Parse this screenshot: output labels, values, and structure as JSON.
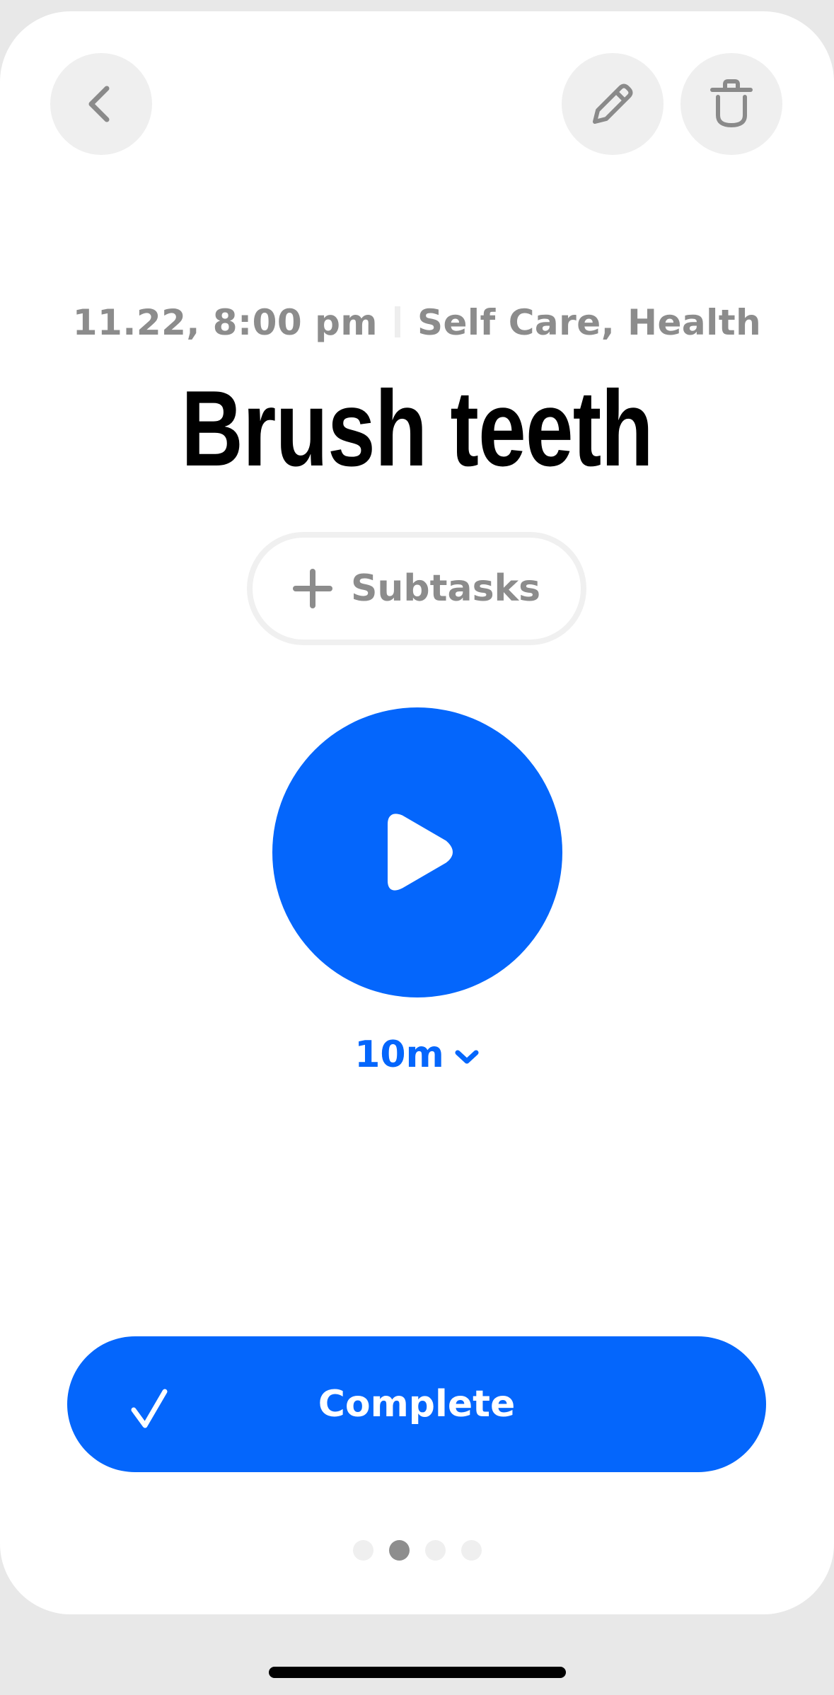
{
  "header": {
    "back_icon": "chevron-left-icon",
    "edit_icon": "pencil-icon",
    "delete_icon": "trash-icon"
  },
  "task": {
    "date_time": "11.22, 8:00 pm",
    "categories": "Self Care, Health",
    "title": "Brush teeth"
  },
  "subtasks": {
    "label": "Subtasks",
    "icon": "plus-icon"
  },
  "timer": {
    "icon": "play-icon",
    "duration": "10m",
    "dropdown_icon": "chevron-down-icon"
  },
  "complete": {
    "label": "Complete",
    "icon": "check-icon"
  },
  "pagination": {
    "total": 4,
    "active_index": 1
  },
  "colors": {
    "accent": "#0466fc",
    "secondary_text": "#8c8c8c",
    "button_bg": "#efefef"
  }
}
